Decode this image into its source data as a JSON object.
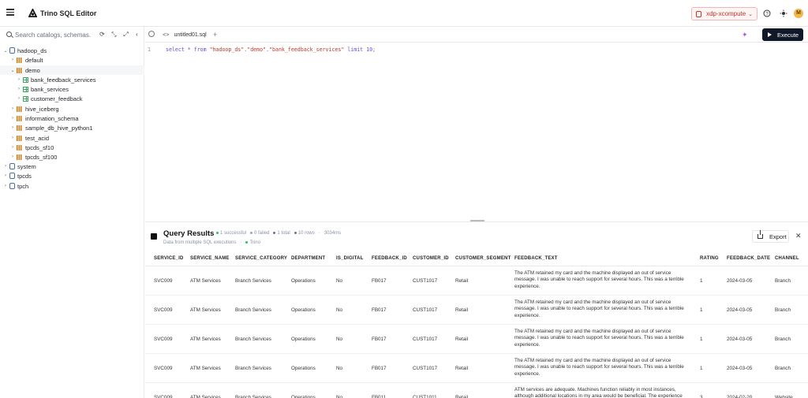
{
  "header": {
    "app_title": "Trino SQL Editor",
    "cluster": "xdp-xcompute",
    "avatar_initial": "M",
    "icons": [
      "menu-icon",
      "trino-logo",
      "help-icon",
      "theme-icon"
    ]
  },
  "sidebar": {
    "search_placeholder": "Search catalogs, schemas...",
    "tree": [
      {
        "label": "hadoop_ds",
        "type": "catalog",
        "expanded": true
      },
      {
        "label": "default",
        "type": "schema"
      },
      {
        "label": "demo",
        "type": "schema",
        "expanded": true
      },
      {
        "label": "bank_feedback_services",
        "type": "table"
      },
      {
        "label": "bank_services",
        "type": "table"
      },
      {
        "label": "customer_feedback",
        "type": "table"
      },
      {
        "label": "hive_iceberg",
        "type": "schema"
      },
      {
        "label": "information_schema",
        "type": "schema"
      },
      {
        "label": "sample_db_hive_python1",
        "type": "schema"
      },
      {
        "label": "test_acid",
        "type": "schema"
      },
      {
        "label": "tpcds_sf10",
        "type": "schema"
      },
      {
        "label": "tpcds_sf100",
        "type": "schema"
      },
      {
        "label": "system",
        "type": "catalog"
      },
      {
        "label": "tpcds",
        "type": "catalog"
      },
      {
        "label": "tpch",
        "type": "catalog"
      }
    ]
  },
  "editor": {
    "tab_label": "untitled01.sql",
    "execute_label": "Execute",
    "line_number": "1",
    "code_kw1": "select * from ",
    "code_str1": "\"hadoop_ds\"",
    "code_dot1": ".",
    "code_str2": "\"demo\"",
    "code_dot2": ".",
    "code_str3": "\"bank_feedback_services\"",
    "code_kw2": " limit 10;"
  },
  "results": {
    "title": "Query Results",
    "stats": [
      "1 successful",
      "0 failed",
      "1 total",
      "10 rows",
      "3034ms"
    ],
    "subtitle": "Data from multiple SQL executions",
    "engine": "Trino",
    "export_label": "Export",
    "columns": [
      "SERVICE_ID",
      "SERVICE_NAME",
      "SERVICE_CATEGORY",
      "DEPARTMENT",
      "IS_DIGITAL",
      "FEEDBACK_ID",
      "CUSTOMER_ID",
      "CUSTOMER_SEGMENT",
      "FEEDBACK_TEXT",
      "RATING",
      "FEEDBACK_DATE",
      "CHANNEL"
    ],
    "rows": [
      [
        "SVC009",
        "ATM Services",
        "Branch Services",
        "Operations",
        "No",
        "FB017",
        "CUST1017",
        "Retail",
        "The ATM retained my card and the machine displayed an out of service message. I was unable to reach support for several hours. This was a terrible experience.",
        "1",
        "2024-03-05",
        "Branch"
      ],
      [
        "SVC009",
        "ATM Services",
        "Branch Services",
        "Operations",
        "No",
        "FB017",
        "CUST1017",
        "Retail",
        "The ATM retained my card and the machine displayed an out of service message. I was unable to reach support for several hours. This was a terrible experience.",
        "1",
        "2024-03-05",
        "Branch"
      ],
      [
        "SVC009",
        "ATM Services",
        "Branch Services",
        "Operations",
        "No",
        "FB017",
        "CUST1017",
        "Retail",
        "The ATM retained my card and the machine displayed an out of service message. I was unable to reach support for several hours. This was a terrible experience.",
        "1",
        "2024-03-05",
        "Branch"
      ],
      [
        "SVC009",
        "ATM Services",
        "Branch Services",
        "Operations",
        "No",
        "FB017",
        "CUST1017",
        "Retail",
        "The ATM retained my card and the machine displayed an out of service message. I was unable to reach support for several hours. This was a terrible experience.",
        "1",
        "2024-03-05",
        "Branch"
      ],
      [
        "SVC009",
        "ATM Services",
        "Branch Services",
        "Operations",
        "No",
        "FB011",
        "CUST1011",
        "Retail",
        "ATM services are adequate. Machines function reliably in most instances, although additional locations in my area would be beneficial. The experience",
        "3",
        "2024-02-20",
        "Website"
      ]
    ]
  },
  "colors": {
    "accent": "#111827",
    "success": "#22c55e",
    "failed": "#9ca3af",
    "cluster": "#c0392b",
    "avatar": "#f2b84b"
  }
}
